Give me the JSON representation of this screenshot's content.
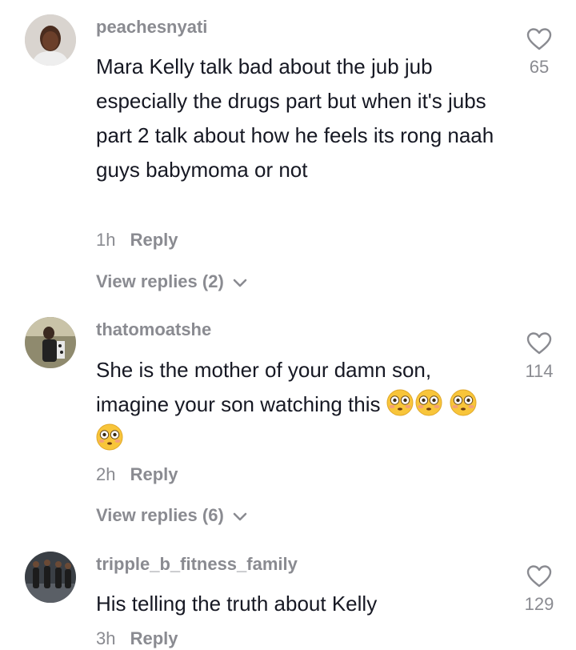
{
  "comments": [
    {
      "username": "peachesnyati",
      "text": "Mara Kelly talk bad about the jub jub especially the drugs part but when it's jubs part 2 talk about how he feels its rong naah guys babymoma or not",
      "time": "1h",
      "reply_label": "Reply",
      "view_replies": "View replies (2)",
      "likes": "65"
    },
    {
      "username": "thatomoatshe",
      "text": "She is the mother of your damn son, imagine your son watching this",
      "emoji": [
        "flushed-face",
        "flushed-face",
        "flushed-face",
        "flushed-face"
      ],
      "time": "2h",
      "reply_label": "Reply",
      "view_replies": "View replies (6)",
      "likes": "114"
    },
    {
      "username": "tripple_b_fitness_family",
      "text": "His telling the truth about Kelly",
      "time": "3h",
      "reply_label": "Reply",
      "likes": "129"
    }
  ],
  "colors": {
    "primary_text": "#161823",
    "secondary_text": "#8a8b91",
    "background": "#ffffff"
  },
  "icons": {
    "like": "heart-outline-icon",
    "expand": "chevron-down-icon",
    "emoji": "flushed-face-emoji"
  }
}
